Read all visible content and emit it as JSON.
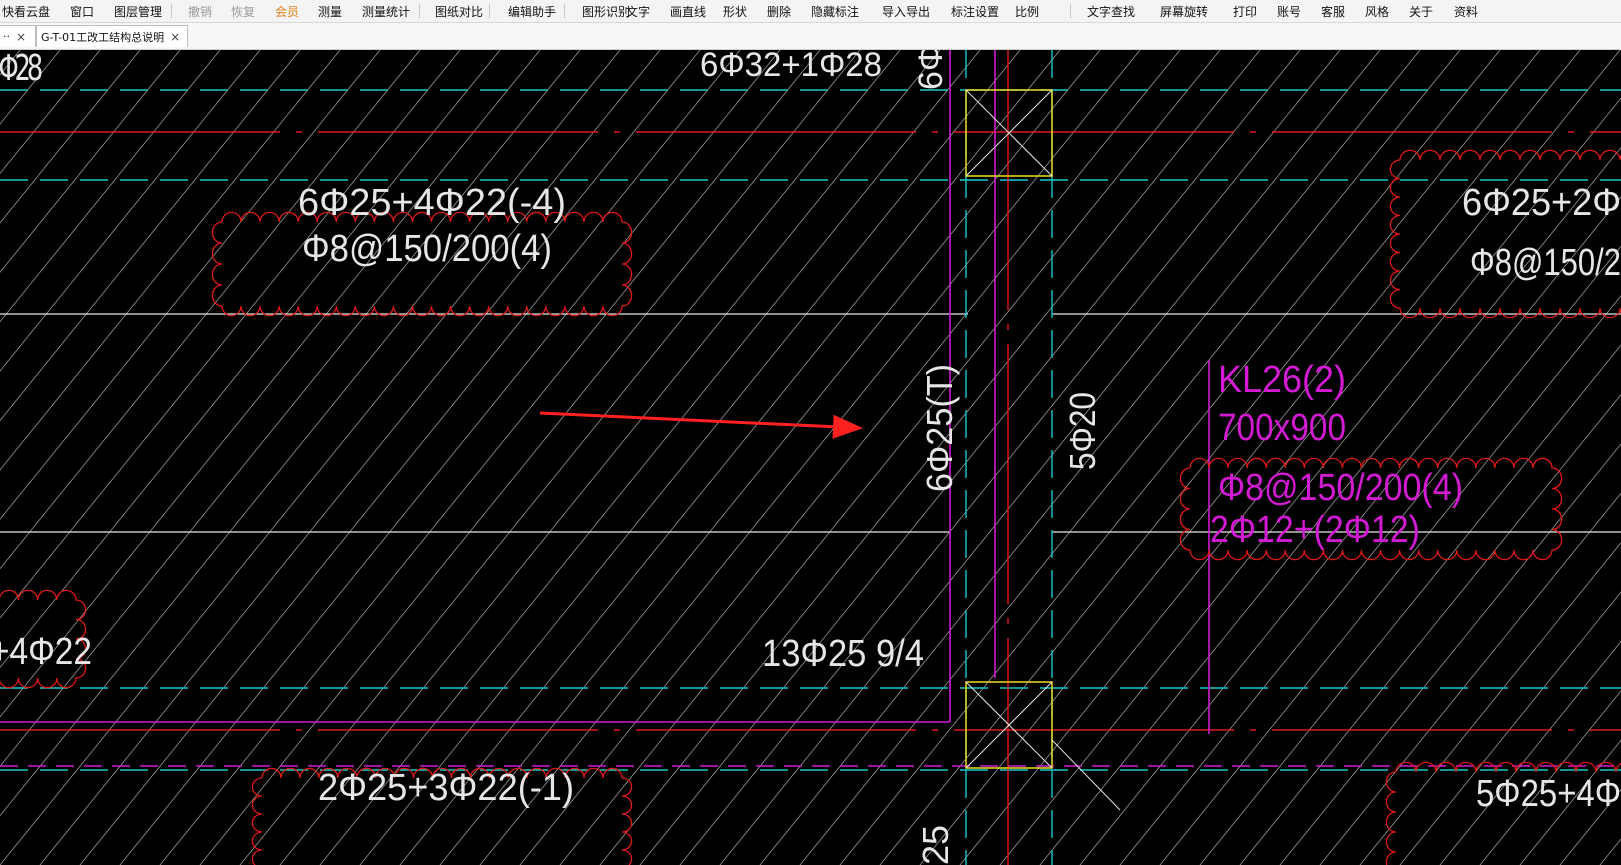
{
  "menu": {
    "items": [
      {
        "label": "快看云盘",
        "state": "normal"
      },
      {
        "label": "窗口",
        "state": "normal"
      },
      {
        "label": "图层管理",
        "state": "normal"
      },
      {
        "label": "撤销",
        "state": "disabled"
      },
      {
        "label": "恢复",
        "state": "disabled"
      },
      {
        "label": "会员",
        "state": "accent"
      },
      {
        "label": "测量",
        "state": "normal"
      },
      {
        "label": "测量统计",
        "state": "normal"
      },
      {
        "label": "图纸对比",
        "state": "normal"
      },
      {
        "label": "编辑助手",
        "state": "normal"
      },
      {
        "label": "图形识别",
        "state": "normal"
      },
      {
        "label": "文字",
        "state": "normal"
      },
      {
        "label": "画直线",
        "state": "normal"
      },
      {
        "label": "形状",
        "state": "normal"
      },
      {
        "label": "删除",
        "state": "normal"
      },
      {
        "label": "隐藏标注",
        "state": "normal"
      },
      {
        "label": "导入导出",
        "state": "normal"
      },
      {
        "label": "标注设置",
        "state": "normal"
      },
      {
        "label": "比例",
        "state": "normal"
      },
      {
        "label": "文字查找",
        "state": "normal"
      },
      {
        "label": "屏幕旋转",
        "state": "normal"
      },
      {
        "label": "打印",
        "state": "normal"
      },
      {
        "label": "账号",
        "state": "normal"
      },
      {
        "label": "客服",
        "state": "normal"
      },
      {
        "label": "风格",
        "state": "normal"
      },
      {
        "label": "关于",
        "state": "normal"
      },
      {
        "label": "资料",
        "state": "normal"
      }
    ]
  },
  "tabs": [
    {
      "label": "··",
      "close": "×"
    },
    {
      "label": "G-T-01工改工结构总说明",
      "close": "×"
    }
  ],
  "drawing": {
    "colors": {
      "background": "#000000",
      "white": "#e6e6e6",
      "hatch": "#9a9a9a",
      "cyan": "#18c8c8",
      "red": "#e01818",
      "magenta": "#d21ad2",
      "yellow": "#e0d020",
      "arrow": "#ff2020"
    },
    "texts": {
      "t_top_left": "Φ28",
      "t_top_mid": "6Φ32+1Φ28",
      "t_top_right_vert": "6Φ",
      "t_beam1_line1": "6Φ25+4Φ22(-4)",
      "t_beam1_line2": "Φ8@150/200(4)",
      "t_beam2_line1": "6Φ25+2Φ",
      "t_beam2_line2": "Φ8@150/2",
      "t_col_vert": "6Φ25(T)",
      "t_col2_vert": "5Φ20",
      "t_kl_1": "KL26(2)",
      "t_kl_2": "700x900",
      "t_kl_3": "Φ8@150/200(4)",
      "t_kl_4": "2Φ12+(2Φ12)",
      "t_left_bottom": "+4Φ22",
      "t_bottom_mid": "13Φ25 9/4",
      "t_bottom_beam": "2Φ25+3Φ22(-1)",
      "t_bottom_right": "5Φ25+4Φ",
      "t_bottom_vert": "25"
    }
  }
}
